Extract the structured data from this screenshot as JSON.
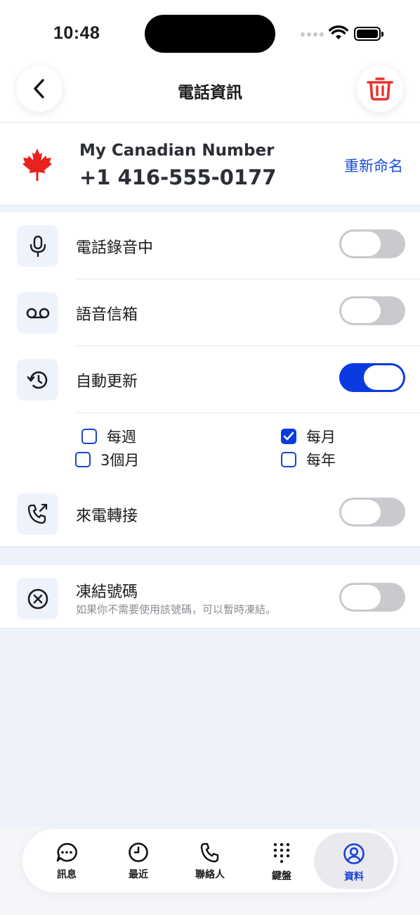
{
  "status_bar": {
    "time": "10:48"
  },
  "header": {
    "title": "電話資訊"
  },
  "number_card": {
    "name": "My Canadian Number",
    "number": "+1 416-555-0177",
    "rename_label": "重新命名",
    "flag": "canada-flag-icon"
  },
  "settings": {
    "recording": {
      "label": "電話錄音中",
      "enabled": false
    },
    "voicemail": {
      "label": "語音信箱",
      "enabled": false
    },
    "auto_renew": {
      "label": "自動更新",
      "enabled": true,
      "options": [
        {
          "label": "每週",
          "checked": false
        },
        {
          "label": "每月",
          "checked": true
        },
        {
          "label": "3個月",
          "checked": false
        },
        {
          "label": "每年",
          "checked": false
        }
      ]
    },
    "call_forwarding": {
      "label": "來電轉接",
      "enabled": false
    }
  },
  "freeze": {
    "title": "凍結號碼",
    "description": "如果你不需要使用該號碼，可以暫時凍結。",
    "enabled": false
  },
  "tabbar": {
    "tabs": [
      {
        "label": "訊息",
        "icon": "chat-bubble-icon"
      },
      {
        "label": "最近",
        "icon": "clock-icon"
      },
      {
        "label": "聯絡人",
        "icon": "phone-icon"
      },
      {
        "label": "鍵盤",
        "icon": "keypad-icon"
      },
      {
        "label": "資料",
        "icon": "profile-icon",
        "active": true
      }
    ]
  },
  "colors": {
    "accent": "#0a3be0",
    "danger": "#e8322b",
    "background": "#eef3fb"
  }
}
